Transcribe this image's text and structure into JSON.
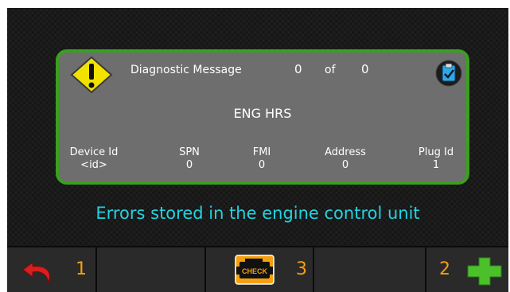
{
  "diagnostic": {
    "title": "Diagnostic Message",
    "current_index": "0",
    "of_label": "of",
    "total": "0",
    "fault_name": "ENG HRS",
    "columns": {
      "device_id": {
        "label": "Device Id",
        "value": "<id>"
      },
      "spn": {
        "label": "SPN",
        "value": "0"
      },
      "fmi": {
        "label": "FMI",
        "value": "0"
      },
      "address": {
        "label": "Address",
        "value": "0"
      },
      "plug_id": {
        "label": "Plug Id",
        "value": "1"
      }
    }
  },
  "info_text": "Errors stored in the engine control unit",
  "softkeys": {
    "back": {
      "number": "1",
      "icon": "back-arrow-icon"
    },
    "check": {
      "number": "3",
      "icon": "check-engine-icon",
      "icon_text": "CHECK"
    },
    "add": {
      "number": "2",
      "icon": "plus-icon"
    }
  },
  "colors": {
    "panel_border": "#39a020",
    "panel_fill": "#6e6e6e",
    "info_text": "#22d3e0",
    "key_number": "#f5a00f",
    "warning": "#f2e200",
    "check_engine": "#f5a00f"
  }
}
